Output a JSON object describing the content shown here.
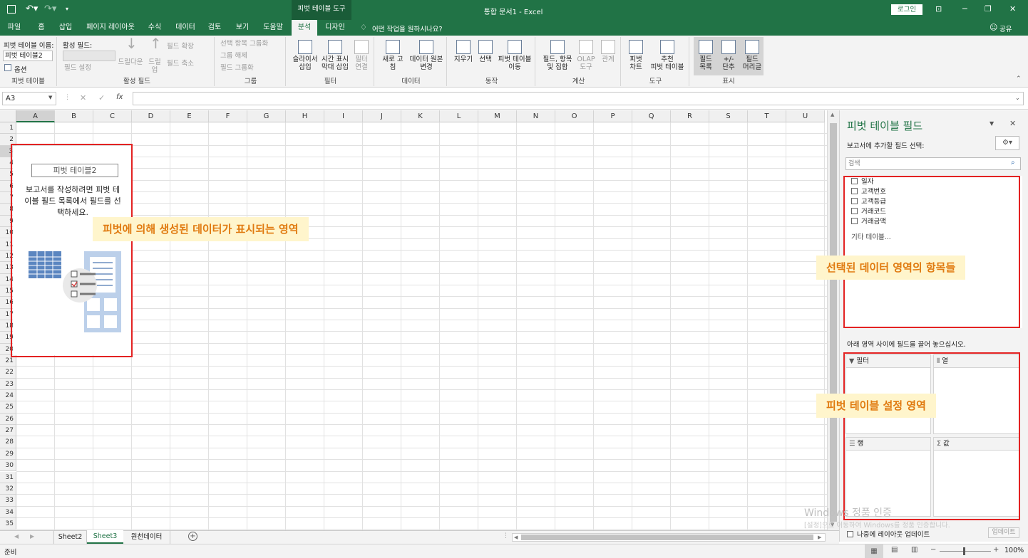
{
  "titlebar": {
    "context_tool": "피벗 테이블 도구",
    "doc_title": "통합 문서1  -  Excel",
    "login_button": "로그인",
    "minimize": "─",
    "restore": "❐",
    "close": "✕"
  },
  "tabs": [
    "파일",
    "홈",
    "삽입",
    "페이지 레이아웃",
    "수식",
    "데이터",
    "검토",
    "보기",
    "도움말",
    "분석",
    "디자인"
  ],
  "active_tab": "분석",
  "tell_me": "어떤 작업을 원하시나요?",
  "share": "공유",
  "ribbon": {
    "pivot_name_label": "피벗 테이블 이름:",
    "pivot_name_value": "피벗 테이블2",
    "options": "옵션",
    "group_pivot": "피벗 테이블",
    "active_field_label": "활성 필드:",
    "field_settings": "필드 설정",
    "drill_down": "드릴다운",
    "drill_up_1": "드릴",
    "drill_up_2": "업",
    "expand_field": "필드 확장",
    "collapse_field": "필드 축소",
    "group_active_field": "활성 필드",
    "group_selection": "선택 항목 그룹화",
    "ungroup": "그룹 해제",
    "group_field": "필드 그룹화",
    "group_group": "그룹",
    "slicer_1": "슬라이서",
    "slicer_2": "삽입",
    "timeline_1": "시간 표시",
    "timeline_2": "막대 삽입",
    "filter_conn_1": "필터",
    "filter_conn_2": "연결",
    "group_filter": "필터",
    "refresh_1": "새로 고",
    "refresh_2": "침",
    "change_source_1": "데이터 원본",
    "change_source_2": "변경",
    "group_data": "데이터",
    "clear": "지우기",
    "select": "선택",
    "move_1": "피벗 테이블",
    "move_2": "이동",
    "group_actions": "동작",
    "fields_items_1": "필드, 항목",
    "fields_items_2": "및 집합",
    "olap_1": "OLAP",
    "olap_2": "도구",
    "relations": "관계",
    "group_calc": "계산",
    "pivot_chart_1": "피벗",
    "pivot_chart_2": "차트",
    "recommended_1": "추천",
    "recommended_2": "피벗 테이블",
    "group_tools": "도구",
    "field_list_1": "필드",
    "field_list_2": "목록",
    "buttons_1": "+/-",
    "buttons_2": "단추",
    "headers_1": "필드",
    "headers_2": "머리글",
    "group_show": "표시"
  },
  "formula_bar": {
    "name_box": "A3",
    "cancel": "✕",
    "enter": "✓",
    "fx": "fx",
    "formula": ""
  },
  "columns": [
    "A",
    "B",
    "C",
    "D",
    "E",
    "F",
    "G",
    "H",
    "I",
    "J",
    "K",
    "L",
    "M",
    "N",
    "O",
    "P",
    "Q",
    "R",
    "S",
    "T",
    "U"
  ],
  "rows": [
    "1",
    "2",
    "3",
    "4",
    "5",
    "6",
    "7",
    "8",
    "9",
    "10",
    "11",
    "12",
    "13",
    "14",
    "15",
    "16",
    "17",
    "18",
    "19",
    "20",
    "21",
    "22",
    "23",
    "24",
    "25",
    "26",
    "27",
    "28",
    "29",
    "30",
    "31",
    "32",
    "33",
    "34",
    "35"
  ],
  "pivot_placeholder": {
    "name": "피벗 테이블2",
    "instruction_1": "보고서를 작성하려면 피벗 테",
    "instruction_2": "이블 필드 목록에서 필드를 선",
    "instruction_3": "택하세요."
  },
  "callouts": {
    "data_area": "피벗에 의해 생성된 데이터가 표시되는 영역",
    "fields_area": "선택된 데이터 영역의 항목들",
    "settings_area": "피벗 테이블 설정 영역"
  },
  "panel": {
    "title": "피벗 테이블 필드",
    "subtitle": "보고서에 추가할 필드 선택:",
    "search_placeholder": "검색",
    "fields": [
      "일자",
      "고객번호",
      "고객등급",
      "거래코드",
      "거래금액"
    ],
    "more_tables": "기타 테이블...",
    "drag_hint": "아래 영역 사이에 필드를 끌어 놓으십시오.",
    "areas": {
      "filter": "필터",
      "columns": "열",
      "rows": "행",
      "values": "값"
    },
    "defer_update": "나중에 레이아웃 업데이트",
    "update_button": "업데이트",
    "watermark_1": "Windows 정품 인증",
    "watermark_2": "[설정]으로 이동하여 Windows를 정품 인증합니다."
  },
  "sheets": [
    "Sheet2",
    "Sheet3",
    "원천데이터"
  ],
  "active_sheet": "Sheet3",
  "status": {
    "ready": "준비",
    "zoom": "100%"
  },
  "colors": {
    "excel_green": "#217346",
    "annotation_red": "#e32222",
    "callout_text": "#e07a10",
    "callout_bg": "#fff5cc"
  }
}
